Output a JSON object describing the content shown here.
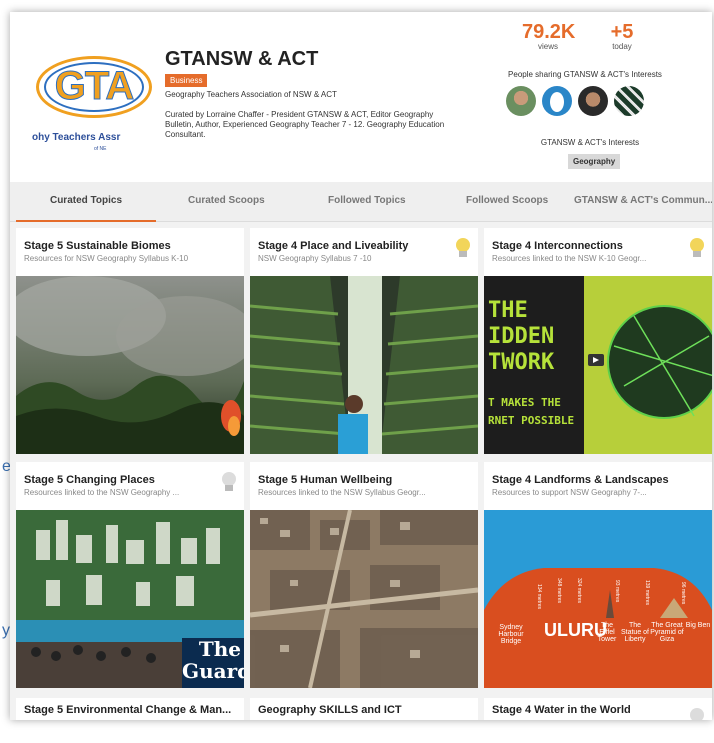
{
  "page": {
    "left_fragment_chars": [
      "e",
      "y"
    ]
  },
  "header": {
    "logo": {
      "letters": "GTA",
      "caption": "ohy Teachers Assr",
      "caption_small": "of NE"
    },
    "title": "GTANSW & ACT",
    "category_badge": "Business",
    "subtitle": "Geography Teachers Association of NSW & ACT",
    "curator_text": "Curated by Lorraine Chaffer - President GTANSW & ACT, Editor Geography Bulletin, Author, Experienced Geography Teacher 7 - 12. Geography Education Consultant.",
    "stats": {
      "views_value": "79.2K",
      "views_label": "views",
      "today_value": "+5",
      "today_label": "today"
    },
    "sharing_label": "People sharing GTANSW & ACT's Interests",
    "interests_label": "GTANSW & ACT's Interests",
    "interest_tag": "Geography"
  },
  "tabs": [
    {
      "label": "Curated Topics",
      "active": true
    },
    {
      "label": "Curated Scoops",
      "active": false
    },
    {
      "label": "Followed Topics",
      "active": false
    },
    {
      "label": "Followed Scoops",
      "active": false
    },
    {
      "label": "GTANSW & ACT's Commun...",
      "active": false
    }
  ],
  "cards": [
    {
      "title": "Stage 5 Sustainable Biomes",
      "desc": "Resources for NSW Geography Syllabus K-10"
    },
    {
      "title": "Stage 4 Place and Liveability",
      "desc": "NSW Geography Syllabus 7 -10"
    },
    {
      "title": "Stage 4 Interconnections",
      "desc": "Resources  linked to the NSW K-10 Geogr..."
    },
    {
      "title": "Stage 5 Changing Places",
      "desc": "Resources  linked to the NSW Geography ..."
    },
    {
      "title": "Stage 5 Human Wellbeing",
      "desc": "Resources linked to the NSW Syllabus Geogr..."
    },
    {
      "title": "Stage 4 Landforms & Landscapes",
      "desc": "Resources to support NSW Geography 7-..."
    },
    {
      "title": "Stage 5 Environmental Change & Man...",
      "desc": ""
    },
    {
      "title": "Geography SKILLS and ICT",
      "desc": ""
    },
    {
      "title": "Stage 4 Water in the World",
      "desc": ""
    }
  ],
  "card_images": {
    "network_lines": [
      "THE",
      "IDDEN",
      "TWORK",
      "T MAKES THE",
      "RNET POSSIBLE"
    ],
    "guardian_lines": [
      "The",
      "Guard"
    ],
    "uluru_main": "ULURU",
    "uluru_labels": [
      "Sydney Harbour Bridge",
      "The Eiffel Tower",
      "The Statue of Liberty",
      "The Great Pyramid of Giza",
      "Big Ben"
    ],
    "uluru_heights": [
      "134 metres",
      "348 metres",
      "324 metres",
      "93 metres",
      "139 metres",
      "96 metres"
    ]
  },
  "colors": {
    "accent": "#e56c2b",
    "tag_bg": "#d8d8d8"
  }
}
